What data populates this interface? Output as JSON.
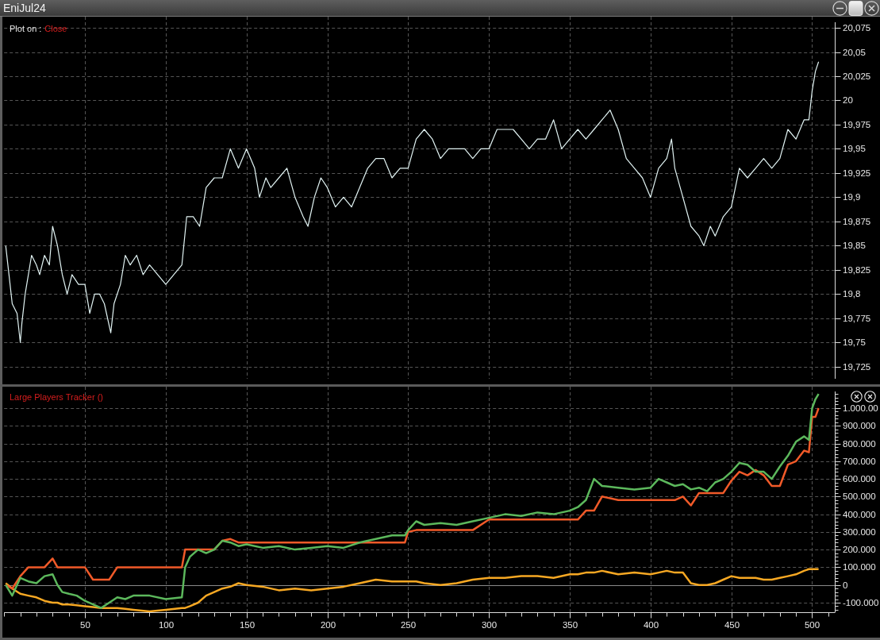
{
  "window": {
    "title": "EniJul24"
  },
  "price_panel": {
    "plot_label": "Plot on :",
    "plot_field": "Close",
    "chart_data": {
      "type": "line",
      "x": [
        1,
        3,
        5,
        8,
        10,
        11,
        13,
        17,
        20,
        22,
        25,
        28,
        30,
        33,
        36,
        39,
        42,
        46,
        50,
        53,
        56,
        59,
        62,
        66,
        68,
        72,
        75,
        78,
        82,
        86,
        90,
        95,
        100,
        105,
        110,
        113,
        117,
        121,
        125,
        130,
        135,
        140,
        145,
        150,
        155,
        158,
        162,
        165,
        170,
        175,
        180,
        185,
        188,
        192,
        196,
        200,
        205,
        210,
        215,
        220,
        225,
        230,
        235,
        240,
        245,
        250,
        255,
        260,
        265,
        270,
        275,
        280,
        285,
        290,
        295,
        300,
        305,
        310,
        315,
        320,
        325,
        330,
        335,
        340,
        345,
        350,
        355,
        360,
        365,
        370,
        375,
        380,
        385,
        390,
        395,
        400,
        405,
        410,
        413,
        415,
        420,
        425,
        430,
        433,
        437,
        440,
        445,
        450,
        455,
        460,
        465,
        470,
        475,
        480,
        485,
        490,
        495,
        498,
        500,
        502,
        504
      ],
      "series": [
        {
          "color": "#e2f4f4",
          "values": [
            19.85,
            19.82,
            19.79,
            19.78,
            19.75,
            19.77,
            19.8,
            19.84,
            19.83,
            19.82,
            19.84,
            19.83,
            19.87,
            19.85,
            19.82,
            19.8,
            19.82,
            19.81,
            19.81,
            19.78,
            19.8,
            19.8,
            19.79,
            19.76,
            19.79,
            19.81,
            19.84,
            19.83,
            19.84,
            19.82,
            19.83,
            19.82,
            19.81,
            19.82,
            19.83,
            19.88,
            19.88,
            19.87,
            19.91,
            19.92,
            19.92,
            19.95,
            19.93,
            19.95,
            19.93,
            19.9,
            19.92,
            19.91,
            19.92,
            19.93,
            19.9,
            19.88,
            19.87,
            19.9,
            19.92,
            19.91,
            19.89,
            19.9,
            19.89,
            19.91,
            19.93,
            19.94,
            19.94,
            19.92,
            19.93,
            19.93,
            19.96,
            19.97,
            19.96,
            19.94,
            19.95,
            19.95,
            19.95,
            19.94,
            19.95,
            19.95,
            19.97,
            19.97,
            19.97,
            19.96,
            19.95,
            19.96,
            19.96,
            19.98,
            19.95,
            19.96,
            19.97,
            19.96,
            19.97,
            19.98,
            19.99,
            19.97,
            19.94,
            19.93,
            19.92,
            19.9,
            19.93,
            19.94,
            19.96,
            19.93,
            19.9,
            19.87,
            19.86,
            19.85,
            19.87,
            19.86,
            19.88,
            19.89,
            19.93,
            19.92,
            19.93,
            19.94,
            19.93,
            19.94,
            19.97,
            19.96,
            19.98,
            19.98,
            20.01,
            20.03,
            20.04
          ]
        }
      ],
      "xlim": [
        0,
        514
      ],
      "ylim": [
        19.7125,
        20.0865
      ],
      "grid": true,
      "yticks": [
        {
          "value": 20.075,
          "label": "20,075"
        },
        {
          "value": 20.05,
          "label": "20,05"
        },
        {
          "value": 20.025,
          "label": "20,025"
        },
        {
          "value": 20,
          "label": "20"
        },
        {
          "value": 19.975,
          "label": "19,975"
        },
        {
          "value": 19.95,
          "label": "19,95"
        },
        {
          "value": 19.925,
          "label": "19,925"
        },
        {
          "value": 19.9,
          "label": "19,9"
        },
        {
          "value": 19.875,
          "label": "19,875"
        },
        {
          "value": 19.85,
          "label": "19,85"
        },
        {
          "value": 19.825,
          "label": "19,825"
        },
        {
          "value": 19.8,
          "label": "19,8"
        },
        {
          "value": 19.775,
          "label": "19,775"
        },
        {
          "value": 19.75,
          "label": "19,75"
        },
        {
          "value": 19.725,
          "label": "19,725"
        }
      ]
    }
  },
  "indicator_panel": {
    "title": "Large Players Tracker ()",
    "chart_data": {
      "type": "line",
      "x": [
        1,
        5,
        10,
        15,
        20,
        25,
        30,
        33,
        36,
        40,
        45,
        50,
        55,
        60,
        65,
        70,
        75,
        80,
        90,
        100,
        110,
        112,
        115,
        120,
        125,
        130,
        135,
        140,
        145,
        150,
        160,
        170,
        180,
        190,
        200,
        210,
        220,
        230,
        240,
        248,
        250,
        255,
        260,
        270,
        280,
        290,
        300,
        310,
        320,
        330,
        340,
        350,
        355,
        360,
        365,
        370,
        380,
        390,
        400,
        405,
        410,
        415,
        420,
        425,
        430,
        435,
        440,
        445,
        450,
        455,
        460,
        465,
        470,
        475,
        480,
        485,
        490,
        495,
        498,
        500,
        502,
        504
      ],
      "series": [
        {
          "color": "#f7a823",
          "values": [
            10000,
            -20000,
            -50000,
            -60000,
            -70000,
            -90000,
            -100000,
            -100000,
            -110000,
            -110000,
            -115000,
            -120000,
            -125000,
            -130000,
            -130000,
            -130000,
            -135000,
            -140000,
            -150000,
            -140000,
            -130000,
            -130000,
            -120000,
            -100000,
            -60000,
            -40000,
            -20000,
            -10000,
            10000,
            0,
            -10000,
            -30000,
            -20000,
            -30000,
            -20000,
            -10000,
            10000,
            30000,
            20000,
            20000,
            20000,
            20000,
            10000,
            0,
            10000,
            30000,
            40000,
            40000,
            50000,
            50000,
            40000,
            60000,
            60000,
            70000,
            70000,
            80000,
            60000,
            70000,
            60000,
            70000,
            80000,
            70000,
            70000,
            10000,
            0,
            0,
            10000,
            30000,
            50000,
            40000,
            40000,
            40000,
            30000,
            30000,
            40000,
            50000,
            60000,
            80000,
            90000,
            90000,
            90000,
            90000
          ]
        },
        {
          "color": "#f15a29",
          "values": [
            0,
            -20000,
            50000,
            100000,
            100000,
            100000,
            150000,
            100000,
            100000,
            100000,
            100000,
            100000,
            30000,
            30000,
            30000,
            100000,
            100000,
            100000,
            100000,
            100000,
            100000,
            200000,
            200000,
            200000,
            200000,
            200000,
            250000,
            260000,
            240000,
            240000,
            240000,
            240000,
            240000,
            240000,
            240000,
            240000,
            240000,
            240000,
            240000,
            240000,
            300000,
            310000,
            310000,
            310000,
            310000,
            310000,
            370000,
            370000,
            370000,
            370000,
            370000,
            370000,
            370000,
            420000,
            420000,
            500000,
            480000,
            480000,
            480000,
            480000,
            480000,
            480000,
            500000,
            450000,
            520000,
            520000,
            520000,
            520000,
            590000,
            640000,
            620000,
            650000,
            620000,
            560000,
            560000,
            680000,
            700000,
            760000,
            750000,
            950000,
            950000,
            1000000
          ]
        },
        {
          "color": "#5cb85c",
          "values": [
            0,
            -60000,
            40000,
            20000,
            10000,
            50000,
            60000,
            0,
            -40000,
            -50000,
            -60000,
            -90000,
            -110000,
            -130000,
            -100000,
            -70000,
            -80000,
            -60000,
            -60000,
            -80000,
            -70000,
            100000,
            160000,
            200000,
            180000,
            200000,
            250000,
            240000,
            220000,
            230000,
            210000,
            220000,
            200000,
            210000,
            220000,
            210000,
            240000,
            260000,
            280000,
            280000,
            310000,
            360000,
            340000,
            350000,
            340000,
            360000,
            380000,
            400000,
            390000,
            410000,
            400000,
            420000,
            440000,
            480000,
            600000,
            560000,
            550000,
            540000,
            550000,
            600000,
            580000,
            560000,
            570000,
            540000,
            550000,
            530000,
            580000,
            600000,
            640000,
            690000,
            680000,
            640000,
            640000,
            600000,
            670000,
            730000,
            810000,
            840000,
            820000,
            1000000,
            1050000,
            1080000
          ]
        }
      ],
      "xlim": [
        0,
        514
      ],
      "ylim": [
        -154000,
        1121000
      ],
      "grid": true,
      "xticks": [
        50,
        100,
        150,
        200,
        250,
        300,
        350,
        400,
        450,
        500
      ],
      "yticks": [
        {
          "value": 1000000,
          "label": "1.000.00"
        },
        {
          "value": 900000,
          "label": "900.000"
        },
        {
          "value": 800000,
          "label": "800.000"
        },
        {
          "value": 700000,
          "label": "700.000"
        },
        {
          "value": 600000,
          "label": "600.000"
        },
        {
          "value": 500000,
          "label": "500.000"
        },
        {
          "value": 400000,
          "label": "400.000"
        },
        {
          "value": 300000,
          "label": "300.000"
        },
        {
          "value": 200000,
          "label": "200.000"
        },
        {
          "value": 100000,
          "label": "100.000"
        },
        {
          "value": 0,
          "label": "0"
        },
        {
          "value": -100000,
          "label": "-100.000"
        }
      ]
    }
  }
}
